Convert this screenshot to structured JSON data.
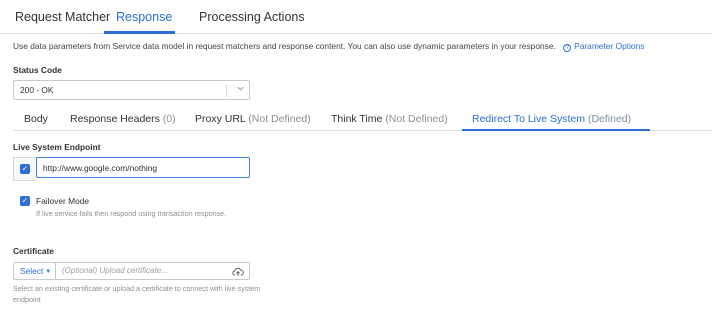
{
  "top_tabs": [
    "Request Matcher",
    "Response",
    "Processing Actions"
  ],
  "active_top_tab": "Response",
  "info": {
    "text": "Use data parameters from Service data model in request matchers and response content. You can also use dynamic parameters in your response.",
    "link_label": "Parameter Options",
    "link_icon": "help-circle-icon"
  },
  "status_code": {
    "label": "Status Code",
    "value": "200 - OK"
  },
  "sub_tabs": [
    {
      "label": "Body",
      "status": ""
    },
    {
      "label": "Response Headers",
      "status": "(0)"
    },
    {
      "label": "Proxy URL",
      "status": "(Not Defined)"
    },
    {
      "label": "Think Time",
      "status": "(Not Defined)"
    },
    {
      "label": "Redirect To Live System",
      "status": "(Defined)"
    }
  ],
  "active_sub_tab": "Redirect To Live System",
  "live_system": {
    "label": "Live System Endpoint",
    "enabled": true,
    "url": "http://www.google.com/nothing"
  },
  "failover": {
    "checked": true,
    "title": "Failover Mode",
    "description": "If live service fails then respond using transaction response."
  },
  "certificate": {
    "label": "Certificate",
    "select_label": "Select",
    "placeholder": "(Optional) Upload certificate...",
    "upload_icon": "cloud-upload-icon",
    "help": "Select an existing certificate or upload a certificate to connect with live system endpoint"
  },
  "colors": {
    "accent": "#2c6ed5",
    "border": "#c6cbd1",
    "muted_text": "#8a9097"
  }
}
